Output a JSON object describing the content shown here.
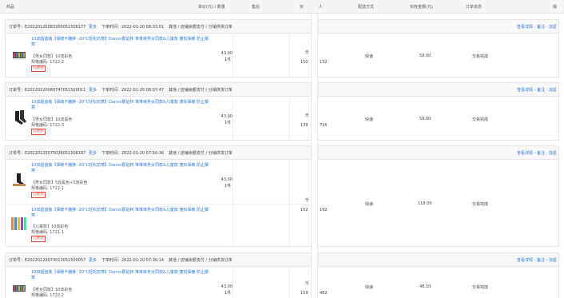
{
  "columns": {
    "product": "商品",
    "price_qty": "单价(元) / 数量",
    "aftersale": "售后",
    "buyer": "买",
    "buyer_tail": "人",
    "delivery": "配送方式",
    "paid": "实收金额(元)",
    "status": "订单状态",
    "ops": "操"
  },
  "colors": {
    "link": "#2d7cd6",
    "tag": "#e43"
  },
  "common": {
    "more": "更多",
    "pay_info": "其他 / 店铺余额支付 / 分销供货订单",
    "actions": "查看详情 - 备注 - 加星",
    "delivery": "快递",
    "status": "交易完成",
    "tag": "已退货",
    "product_title": "10双超值装【保暖不臃肿 -20°C轻松抗寒】Danno霍珀林 堆堆袜男女同款&儿童款 蓬松保暖 防止脚寒",
    "qty": "1件"
  },
  "orders": [
    {
      "order_no": "订单号：E20220120083300051506177",
      "time": "下单时间：2022-01-20 08:33:01",
      "items": [
        {
          "spec": "【男女同款】10双彩色",
          "code": "规格编码: 1722-2",
          "price": "43.00"
        }
      ],
      "paid": "59.00",
      "buyer_clip_top": "乐",
      "buyer_clip_num": "150",
      "buyer_clip_tail": "132"
    },
    {
      "order_no": "订单号：E20220120080747051500011",
      "time": "下单时间：2022-01-20 08:07:47",
      "items": [
        {
          "spec": "【男女同款】10双黑色",
          "code": "规格编码: 1722-3",
          "price": "43.00"
        }
      ],
      "paid": "59.00",
      "buyer_clip_top": "乐",
      "buyer_clip_num": "139",
      "buyer_clip_tail": "715"
    },
    {
      "order_no": "订单号：E20220120075036051506187",
      "time": "下单时间：2022-01-20 07:50:36",
      "items": [
        {
          "spec": "【男女同款】5双黑色+5双彩色",
          "code": "规格编码: 1722-1",
          "price": "43.00"
        },
        {
          "spec": "【儿童款】10双彩色",
          "code": "规格编码: 1721-1",
          "price": "43.00"
        }
      ],
      "paid": "118.00",
      "buyer_clip_top": "乐",
      "buyer_clip_num": "152",
      "buyer_clip_tail": "192"
    },
    {
      "order_no": "订单号：E20220120073013051500057",
      "time": "下单时间：2022-01-20 07:30:14",
      "items": [
        {
          "spec": "【男女同款】10双彩色",
          "code": "规格编码: 1722-2",
          "price": "43.00"
        }
      ],
      "paid": "48.10",
      "buyer_clip_top": "乐",
      "buyer_clip_num": "159",
      "buyer_clip_tail": "482"
    }
  ]
}
